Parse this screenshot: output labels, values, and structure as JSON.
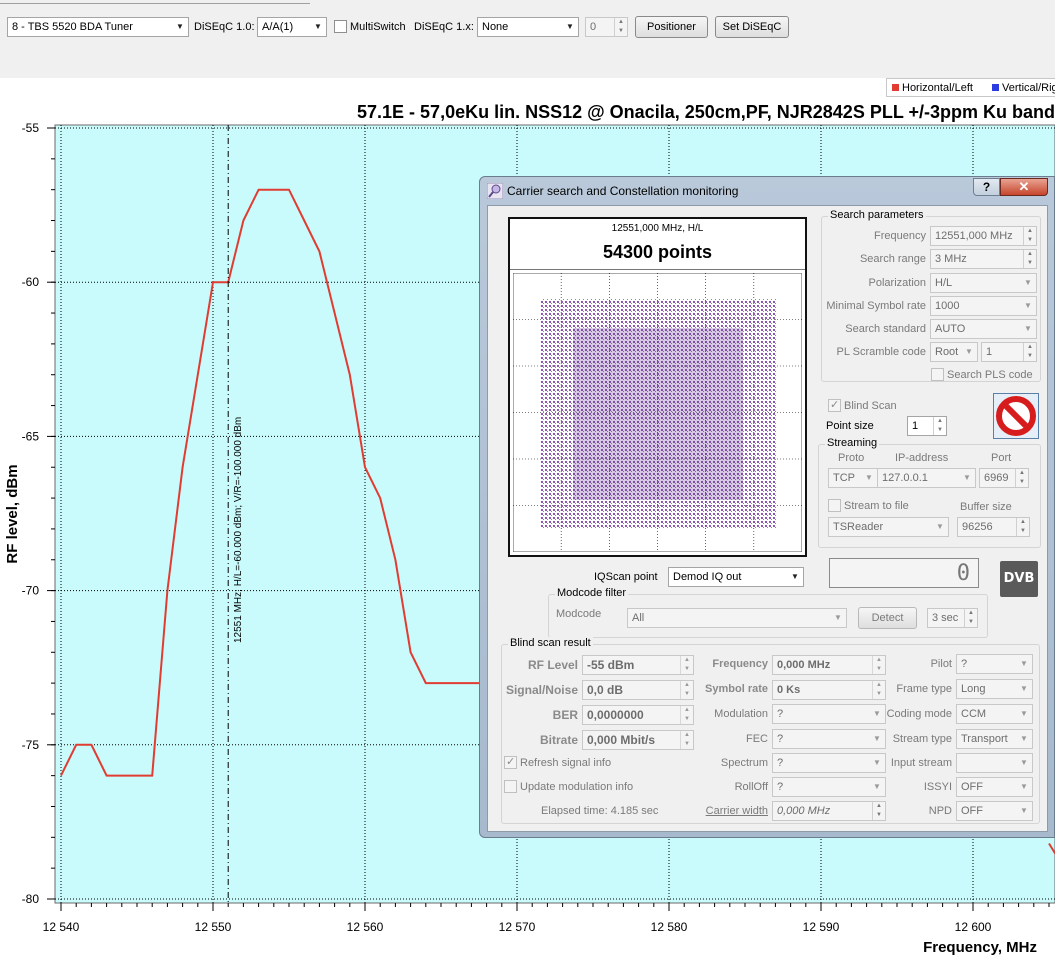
{
  "toolbar": {
    "tuner": "8 - TBS 5520 BDA Tuner",
    "diseqc10_label": "DiSEqC 1.0:",
    "diseqc10_value": "A/A(1)",
    "multiswitch_label": "MultiSwitch",
    "diseqc1x_label": "DiSEqC 1.x:",
    "diseqc1x_value": "None",
    "diseqc1x_num": "0",
    "positioner_label": "Positioner",
    "set_diseqc_label": "Set DiSEqC"
  },
  "legend": {
    "items": [
      {
        "label": "Horizontal/Left",
        "color": "#e03c31"
      },
      {
        "label": "Vertical/Right",
        "color": "#2b3de0"
      }
    ]
  },
  "chart_data": {
    "type": "line",
    "title": "57.1E - 57,0eKu lin. NSS12 @ Onacila, 250cm,PF, NJR2842S PLL +/-3ppm Ku band",
    "xlabel": "Frequency, MHz",
    "ylabel": "RF level, dBm",
    "xlim": [
      12540,
      12605
    ],
    "ylim": [
      -80,
      -55
    ],
    "x_ticks": [
      12540,
      12550,
      12560,
      12570,
      12580,
      12590,
      12600
    ],
    "x_tick_labels": [
      "12 540",
      "12 550",
      "12 560",
      "12 570",
      "12 580",
      "12 590",
      "12 600"
    ],
    "y_ticks": [
      -55,
      -60,
      -65,
      -70,
      -75,
      -80
    ],
    "grid": true,
    "background": "#c9fbfd",
    "series": [
      {
        "name": "Horizontal/Left",
        "color": "#e03c31",
        "x": [
          12540,
          12541,
          12542,
          12543,
          12544,
          12545,
          12546,
          12547,
          12548,
          12549,
          12550,
          12551,
          12552,
          12553,
          12554,
          12555,
          12556,
          12557,
          12558,
          12559,
          12560,
          12561,
          12562,
          12563,
          12564,
          12565,
          12566,
          12567,
          12568
        ],
        "y": [
          -76,
          -75,
          -75,
          -76,
          -76,
          -76,
          -76,
          -70,
          -66,
          -63,
          -60,
          -60,
          -58,
          -57,
          -57,
          -57,
          -58,
          -59,
          -61,
          -63,
          -66,
          -67,
          -69,
          -72,
          -73,
          -73,
          -73,
          -73,
          -73
        ]
      },
      {
        "name": "",
        "color": "#e03c31",
        "x": [
          12605,
          12606
        ],
        "y": [
          -78.2,
          -79
        ]
      }
    ],
    "cursor": {
      "x": 12551,
      "label": "12551 MHz;  H/L=-60.000 dBm;  V/R=-100.000 dBm"
    }
  },
  "dialog": {
    "title": "Carrier search and Constellation monitoring",
    "help": "?",
    "close": "✕",
    "constellation": {
      "freq_label": "12551,000 MHz, H/L",
      "points_label": "54300 points"
    },
    "search_params": {
      "title": "Search parameters",
      "frequency_label": "Frequency",
      "frequency_value": "12551,000 MHz",
      "search_range_label": "Search range",
      "search_range_value": "3 MHz",
      "polarization_label": "Polarization",
      "polarization_value": "H/L",
      "min_sr_label": "Minimal Symbol rate",
      "min_sr_value": "1000",
      "standard_label": "Search standard",
      "standard_value": "AUTO",
      "pls_code_label": "PL Scramble code",
      "pls_mode_value": "Root",
      "pls_code_value": "1",
      "search_pls_label": "Search PLS code"
    },
    "blind_scan_label": "Blind Scan",
    "point_size_label": "Point size",
    "point_size_value": "1",
    "streaming": {
      "title": "Streaming",
      "proto_label": "Proto",
      "ip_label": "IP-address",
      "port_label": "Port",
      "proto_value": "TCP",
      "ip_value": "127.0.0.1",
      "port_value": "6969",
      "stream_file_label": "Stream to file",
      "buffer_label": "Buffer size",
      "reader_value": "TSReader",
      "buffer_value": "96256"
    },
    "lcd_value": "0",
    "dvb_logo": "DVB",
    "iqscan_label": "IQScan point",
    "iqscan_value": "Demod IQ out",
    "modcode": {
      "title": "Modcode filter",
      "label": "Modcode",
      "value": "All",
      "detect_label": "Detect",
      "time_value": "3 sec"
    },
    "result": {
      "title": "Blind scan result",
      "rf_level_label": "RF Level",
      "rf_level_value": "-55 dBm",
      "snr_label": "Signal/Noise",
      "snr_value": "0,0 dB",
      "ber_label": "BER",
      "ber_value": "0,0000000",
      "bitrate_label": "Bitrate",
      "bitrate_value": "0,000 Mbit/s",
      "frequency_label": "Frequency",
      "frequency_value": "0,000 MHz",
      "symbol_rate_label": "Symbol rate",
      "symbol_rate_value": "0 Ks",
      "modulation_label": "Modulation",
      "modulation_value": "?",
      "fec_label": "FEC",
      "fec_value": "?",
      "spectrum_label": "Spectrum",
      "spectrum_value": "?",
      "rolloff_label": "RollOff",
      "rolloff_value": "?",
      "carrier_width_label": "Carrier width",
      "carrier_width_value": "0,000 MHz",
      "pilot_label": "Pilot",
      "pilot_value": "?",
      "frame_type_label": "Frame type",
      "frame_type_value": "Long",
      "coding_mode_label": "Coding mode",
      "coding_mode_value": "CCM",
      "stream_type_label": "Stream type",
      "stream_type_value": "Transport",
      "input_stream_label": "Input stream",
      "input_stream_value": "",
      "issyi_label": "ISSYI",
      "issyi_value": "OFF",
      "npd_label": "NPD",
      "npd_value": "OFF",
      "refresh_label": "Refresh signal info",
      "update_mod_label": "Update modulation info",
      "elapsed": "Elapsed time: 4.185 sec"
    }
  }
}
